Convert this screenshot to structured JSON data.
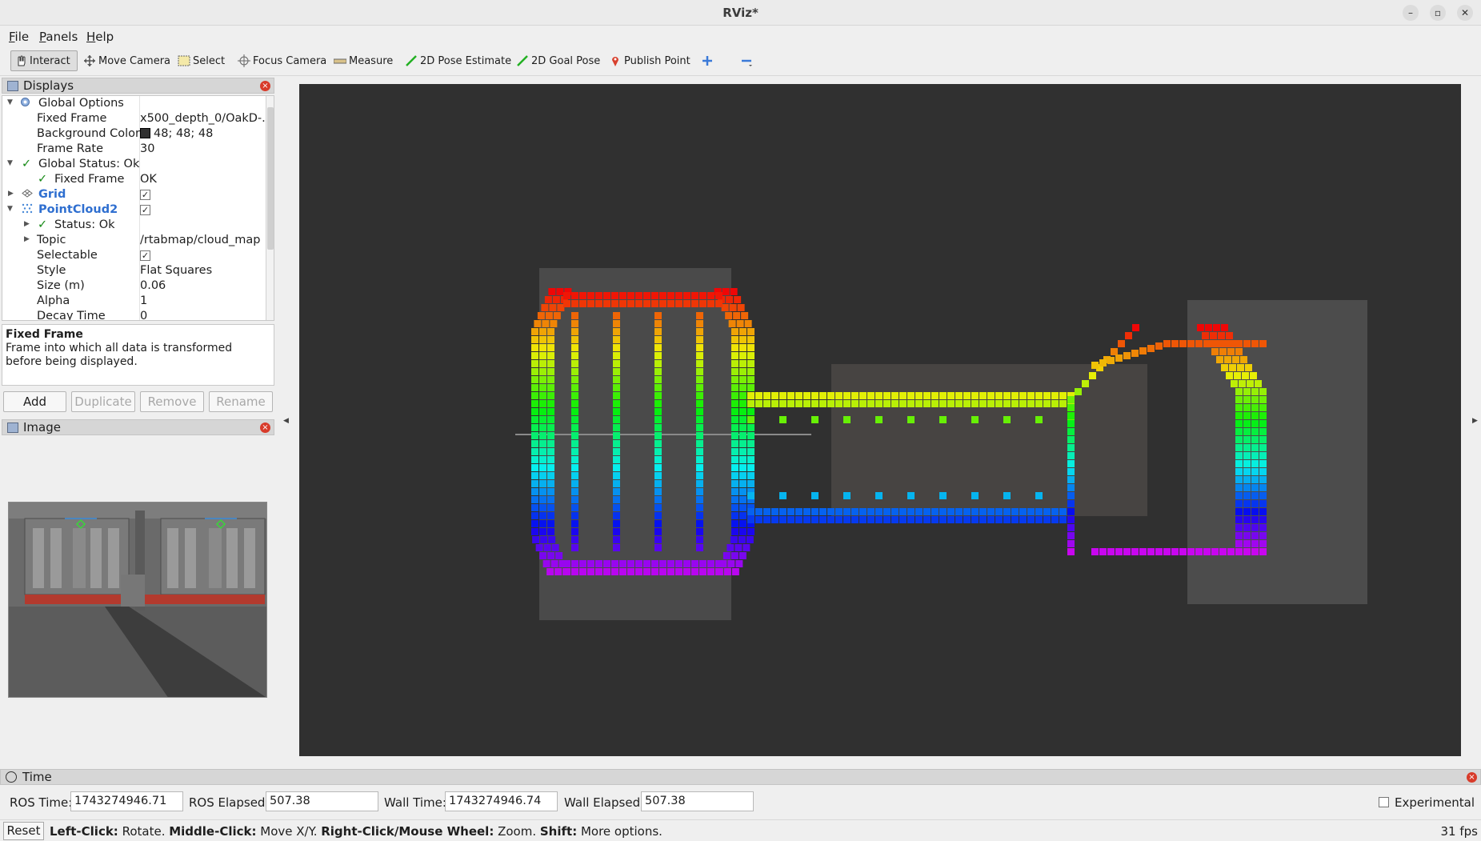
{
  "window": {
    "title": "RViz*"
  },
  "menu": {
    "file": "File",
    "panels": "Panels",
    "help": "Help"
  },
  "toolbar": {
    "interact": "Interact",
    "move_camera": "Move Camera",
    "select": "Select",
    "focus_camera": "Focus Camera",
    "measure": "Measure",
    "pose_estimate": "2D Pose Estimate",
    "goal_pose": "2D Goal Pose",
    "publish_point": "Publish Point"
  },
  "displays": {
    "title": "Displays",
    "global_options": "Global Options",
    "fixed_frame_label": "Fixed Frame",
    "fixed_frame_value": "x500_depth_0/OakD-...",
    "background_color_label": "Background Color",
    "background_color_value": "48; 48; 48",
    "frame_rate_label": "Frame Rate",
    "frame_rate_value": "30",
    "global_status": "Global Status: Ok",
    "status_fixed_frame_label": "Fixed Frame",
    "status_fixed_frame_value": "OK",
    "grid": "Grid",
    "pointcloud": "PointCloud2",
    "pc_status": "Status: Ok",
    "topic_label": "Topic",
    "topic_value": "/rtabmap/cloud_map",
    "selectable_label": "Selectable",
    "style_label": "Style",
    "style_value": "Flat Squares",
    "size_label": "Size (m)",
    "size_value": "0.06",
    "alpha_label": "Alpha",
    "alpha_value": "1",
    "decay_label": "Decay Time",
    "decay_value": "0"
  },
  "description": {
    "heading": "Fixed Frame",
    "text": "Frame into which all data is transformed before being displayed."
  },
  "buttons": {
    "add": "Add",
    "duplicate": "Duplicate",
    "remove": "Remove",
    "rename": "Rename"
  },
  "image_panel": {
    "title": "Image"
  },
  "time": {
    "title": "Time",
    "ros_time_label": "ROS Time:",
    "ros_time_value": "1743274946.71",
    "ros_elapsed_label": "ROS Elapsed:",
    "ros_elapsed_value": "507.38",
    "wall_time_label": "Wall Time:",
    "wall_time_value": "1743274946.74",
    "wall_elapsed_label": "Wall Elapsed:",
    "wall_elapsed_value": "507.38",
    "experimental": "Experimental"
  },
  "status": {
    "reset": "Reset",
    "k1": "Left-Click:",
    "t1": " Rotate. ",
    "k2": "Middle-Click:",
    "t2": " Move X/Y. ",
    "k3": "Right-Click/Mouse Wheel:",
    "t3": " Zoom. ",
    "k4": "Shift:",
    "t4": " More options.",
    "fps": "31 fps"
  },
  "colors": {
    "background": "#303030",
    "accent": "#2f6fd0",
    "ok": "#178a17"
  }
}
